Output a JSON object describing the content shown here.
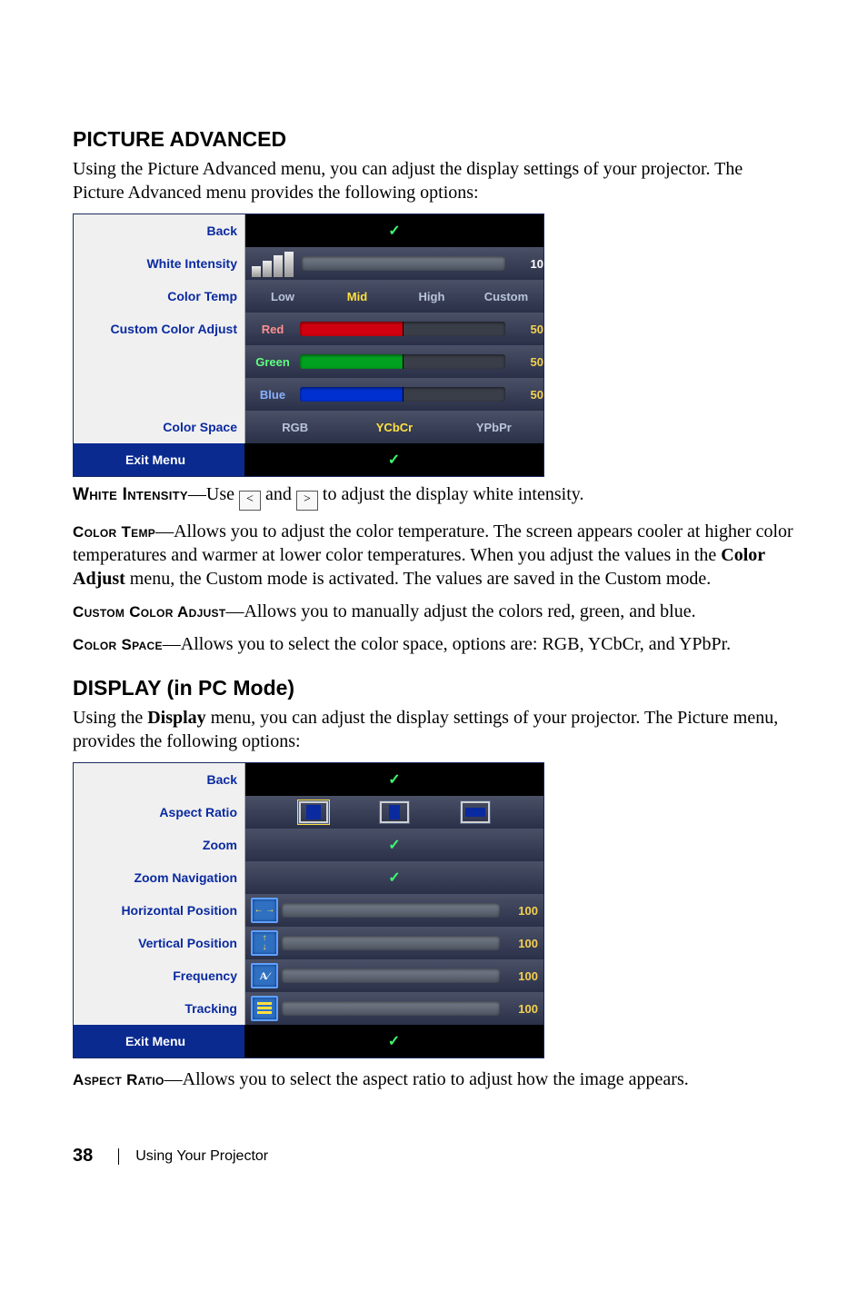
{
  "headings": {
    "picture_advanced": "PICTURE ADVANCED",
    "display_pc": "DISPLAY (in PC Mode)"
  },
  "paragraphs": {
    "pa_intro": "Using the Picture Advanced menu, you can adjust the display settings of your projector. The Picture Advanced menu provides the following options:",
    "white_intensity_pre": "—Use ",
    "white_intensity_mid": " and ",
    "white_intensity_post": " to adjust the display white intensity.",
    "color_temp_body": "—Allows you to adjust the color temperature. The screen appears cooler at higher color temperatures and warmer at lower color temperatures. When you adjust the values in the ",
    "color_temp_body2": " menu, the Custom mode is activated. The values are saved in the Custom mode.",
    "color_adjust_label": "Color Adjust",
    "cca_body": "—Allows you to manually adjust the colors red, green, and blue.",
    "cs_body": "—Allows you to select the color space, options are: RGB, YCbCr, and YPbPr.",
    "display_intro_pre": "Using the ",
    "display_intro_bold": "Display",
    "display_intro_post": " menu, you can adjust the display settings of your projector. The Picture menu, provides the following options:",
    "ar_body": "—Allows you to select the aspect ratio to adjust how the image appears."
  },
  "labels": {
    "white_intensity_sc": "White Intensity",
    "color_temp_sc": "Color Temp",
    "custom_color_adjust_sc": "Custom Color Adjust",
    "color_space_sc": "Color Space",
    "aspect_ratio_sc": "Aspect Ratio"
  },
  "osd1": {
    "rows": {
      "back": "Back",
      "white_intensity": "White Intensity",
      "white_intensity_val": "10",
      "color_temp": "Color Temp",
      "ct_low": "Low",
      "ct_mid": "Mid",
      "ct_high": "High",
      "ct_custom": "Custom",
      "custom_color_adjust": "Custom Color Adjust",
      "red": "Red",
      "green": "Green",
      "blue": "Blue",
      "red_val": "50",
      "green_val": "50",
      "blue_val": "50",
      "color_space": "Color Space",
      "cs_rgb": "RGB",
      "cs_ycbcr": "YCbCr",
      "cs_ypbpr": "YPbPr",
      "exit": "Exit Menu"
    }
  },
  "osd2": {
    "rows": {
      "back": "Back",
      "aspect_ratio": "Aspect Ratio",
      "zoom": "Zoom",
      "zoom_nav": "Zoom Navigation",
      "h_pos": "Horizontal Position",
      "h_pos_val": "100",
      "v_pos": "Vertical Position",
      "v_pos_val": "100",
      "freq": "Frequency",
      "freq_val": "100",
      "tracking": "Tracking",
      "tracking_val": "100",
      "exit": "Exit Menu"
    }
  },
  "footer": {
    "page": "38",
    "section": "Using Your Projector"
  },
  "icons": {
    "left": "<",
    "right": ">"
  }
}
